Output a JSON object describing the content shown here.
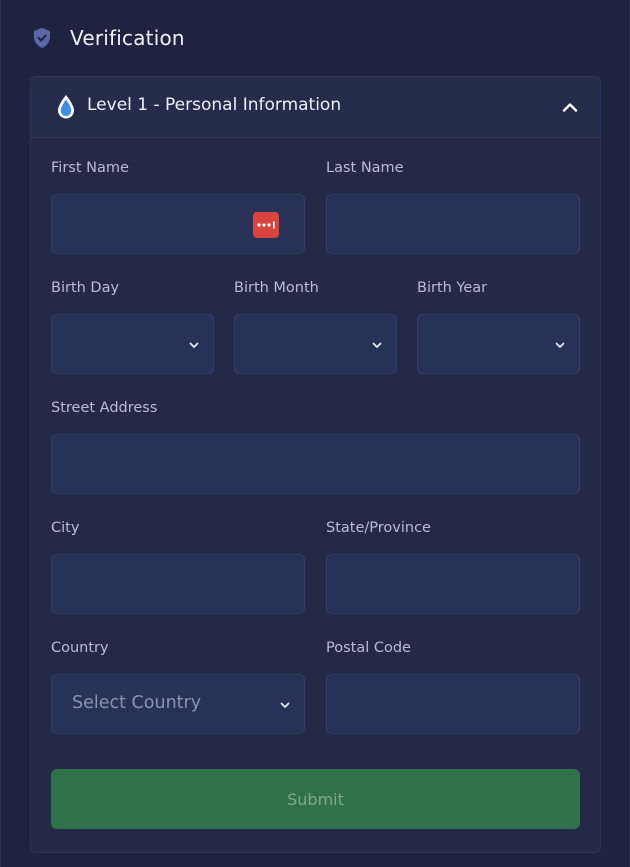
{
  "header": {
    "title": "Verification",
    "icon": "shield-check-icon"
  },
  "section": {
    "title": "Level 1 - Personal Information",
    "icon": "water-drop-icon"
  },
  "form": {
    "first_name": {
      "label": "First Name",
      "value": ""
    },
    "last_name": {
      "label": "Last Name",
      "value": ""
    },
    "birth_day": {
      "label": "Birth Day",
      "value": ""
    },
    "birth_month": {
      "label": "Birth Month",
      "value": ""
    },
    "birth_year": {
      "label": "Birth Year",
      "value": ""
    },
    "street_address": {
      "label": "Street Address",
      "value": ""
    },
    "city": {
      "label": "City",
      "value": ""
    },
    "state": {
      "label": "State/Province",
      "value": ""
    },
    "country": {
      "label": "Country",
      "selected": "Select Country"
    },
    "postal_code": {
      "label": "Postal Code",
      "value": ""
    },
    "submit_label": "Submit"
  },
  "colors": {
    "background": "#1e2340",
    "card": "#232947",
    "field": "#283156",
    "submit": "#2f7148",
    "password_manager": "#d9443f",
    "shield": "#5b67a6",
    "drop": "#3b8fe0"
  }
}
